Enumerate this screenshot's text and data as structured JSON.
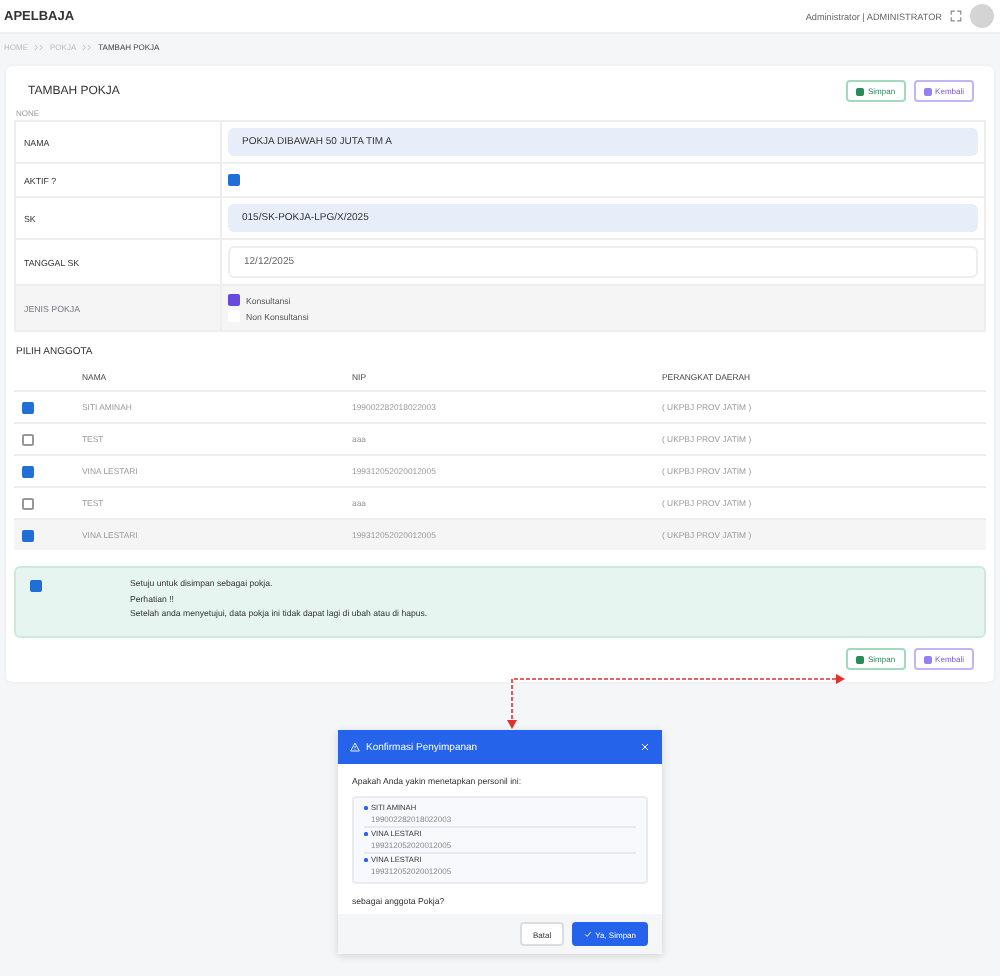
{
  "app": {
    "title": "APELBAJA",
    "user": "Administrator | ADMINISTRATOR"
  },
  "breadcrumb": [
    {
      "label": "HOME",
      "current": false
    },
    {
      "label": "POKJA",
      "current": false
    },
    {
      "label": "TAMBAH POKJA",
      "current": true
    }
  ],
  "card": {
    "title": "TAMBAH POKJA",
    "buttons": [
      {
        "label": "Simpan",
        "kind": "save"
      },
      {
        "label": "Kembali",
        "kind": "back"
      }
    ],
    "note": "NONE"
  },
  "form": [
    {
      "label": "NAMA",
      "kind": "text",
      "value": "POKJA DIBAWAH 50 JUTA TIM A",
      "shaded": false
    },
    {
      "label": "AKTIF ?",
      "kind": "checkbox",
      "checked": true,
      "shaded": false
    },
    {
      "label": "SK",
      "kind": "text",
      "value": "015/SK-POKJA-LPG/X/2025",
      "shaded": false
    },
    {
      "label": "TANGGAL SK",
      "kind": "date",
      "value": "12/12/2025",
      "shaded": false
    },
    {
      "label": "JENIS POKJA",
      "kind": "options",
      "shaded": true,
      "options": [
        {
          "label": "Konsultansi",
          "checked": true
        },
        {
          "label": "Non Konsultansi",
          "checked": false
        }
      ]
    }
  ],
  "members": {
    "title": "PILIH ANGGOTA",
    "columns": [
      "NAMA",
      "NIP",
      "PERANGKAT DAERAH"
    ],
    "rows": [
      {
        "checked": true,
        "name": "SITI AMINAH",
        "nip": "199002282018022003",
        "unit": "( UKPBJ PROV JATIM )"
      },
      {
        "checked": false,
        "name": "TEST",
        "nip": "aaa",
        "unit": "( UKPBJ PROV JATIM )"
      },
      {
        "checked": true,
        "name": "VINA LESTARI",
        "nip": "199312052020012005",
        "unit": "( UKPBJ PROV JATIM )"
      },
      {
        "checked": false,
        "name": "TEST",
        "nip": "aaa",
        "unit": "( UKPBJ PROV JATIM )"
      },
      {
        "checked": true,
        "name": "VINA LESTARI",
        "nip": "199312052020012005",
        "unit": "( UKPBJ PROV JATIM )"
      }
    ]
  },
  "agreement": {
    "checked": true,
    "lines": [
      "Setuju untuk disimpan sebagai pokja.",
      "Perhatian !!",
      "Setelah anda menyetujui, data pokja ini tidak dapat lagi di ubah atau di hapus."
    ]
  },
  "bottom_buttons": [
    {
      "label": "Simpan",
      "kind": "save"
    },
    {
      "label": "Kembali",
      "kind": "back"
    }
  ],
  "modal": {
    "title": "Konfirmasi Penyimpanan",
    "question": "Apakah Anda yakin menetapkan personil ini:",
    "people": [
      {
        "name": "SITI AMINAH",
        "nip": "199002282018022003"
      },
      {
        "name": "VINA LESTARI",
        "nip": "199312052020012005"
      },
      {
        "name": "VINA LESTARI",
        "nip": "199312052020012005"
      }
    ],
    "footer_text": "sebagai anggota Pokja?",
    "cancel": "Batal",
    "confirm": "Ya, Simpan"
  }
}
